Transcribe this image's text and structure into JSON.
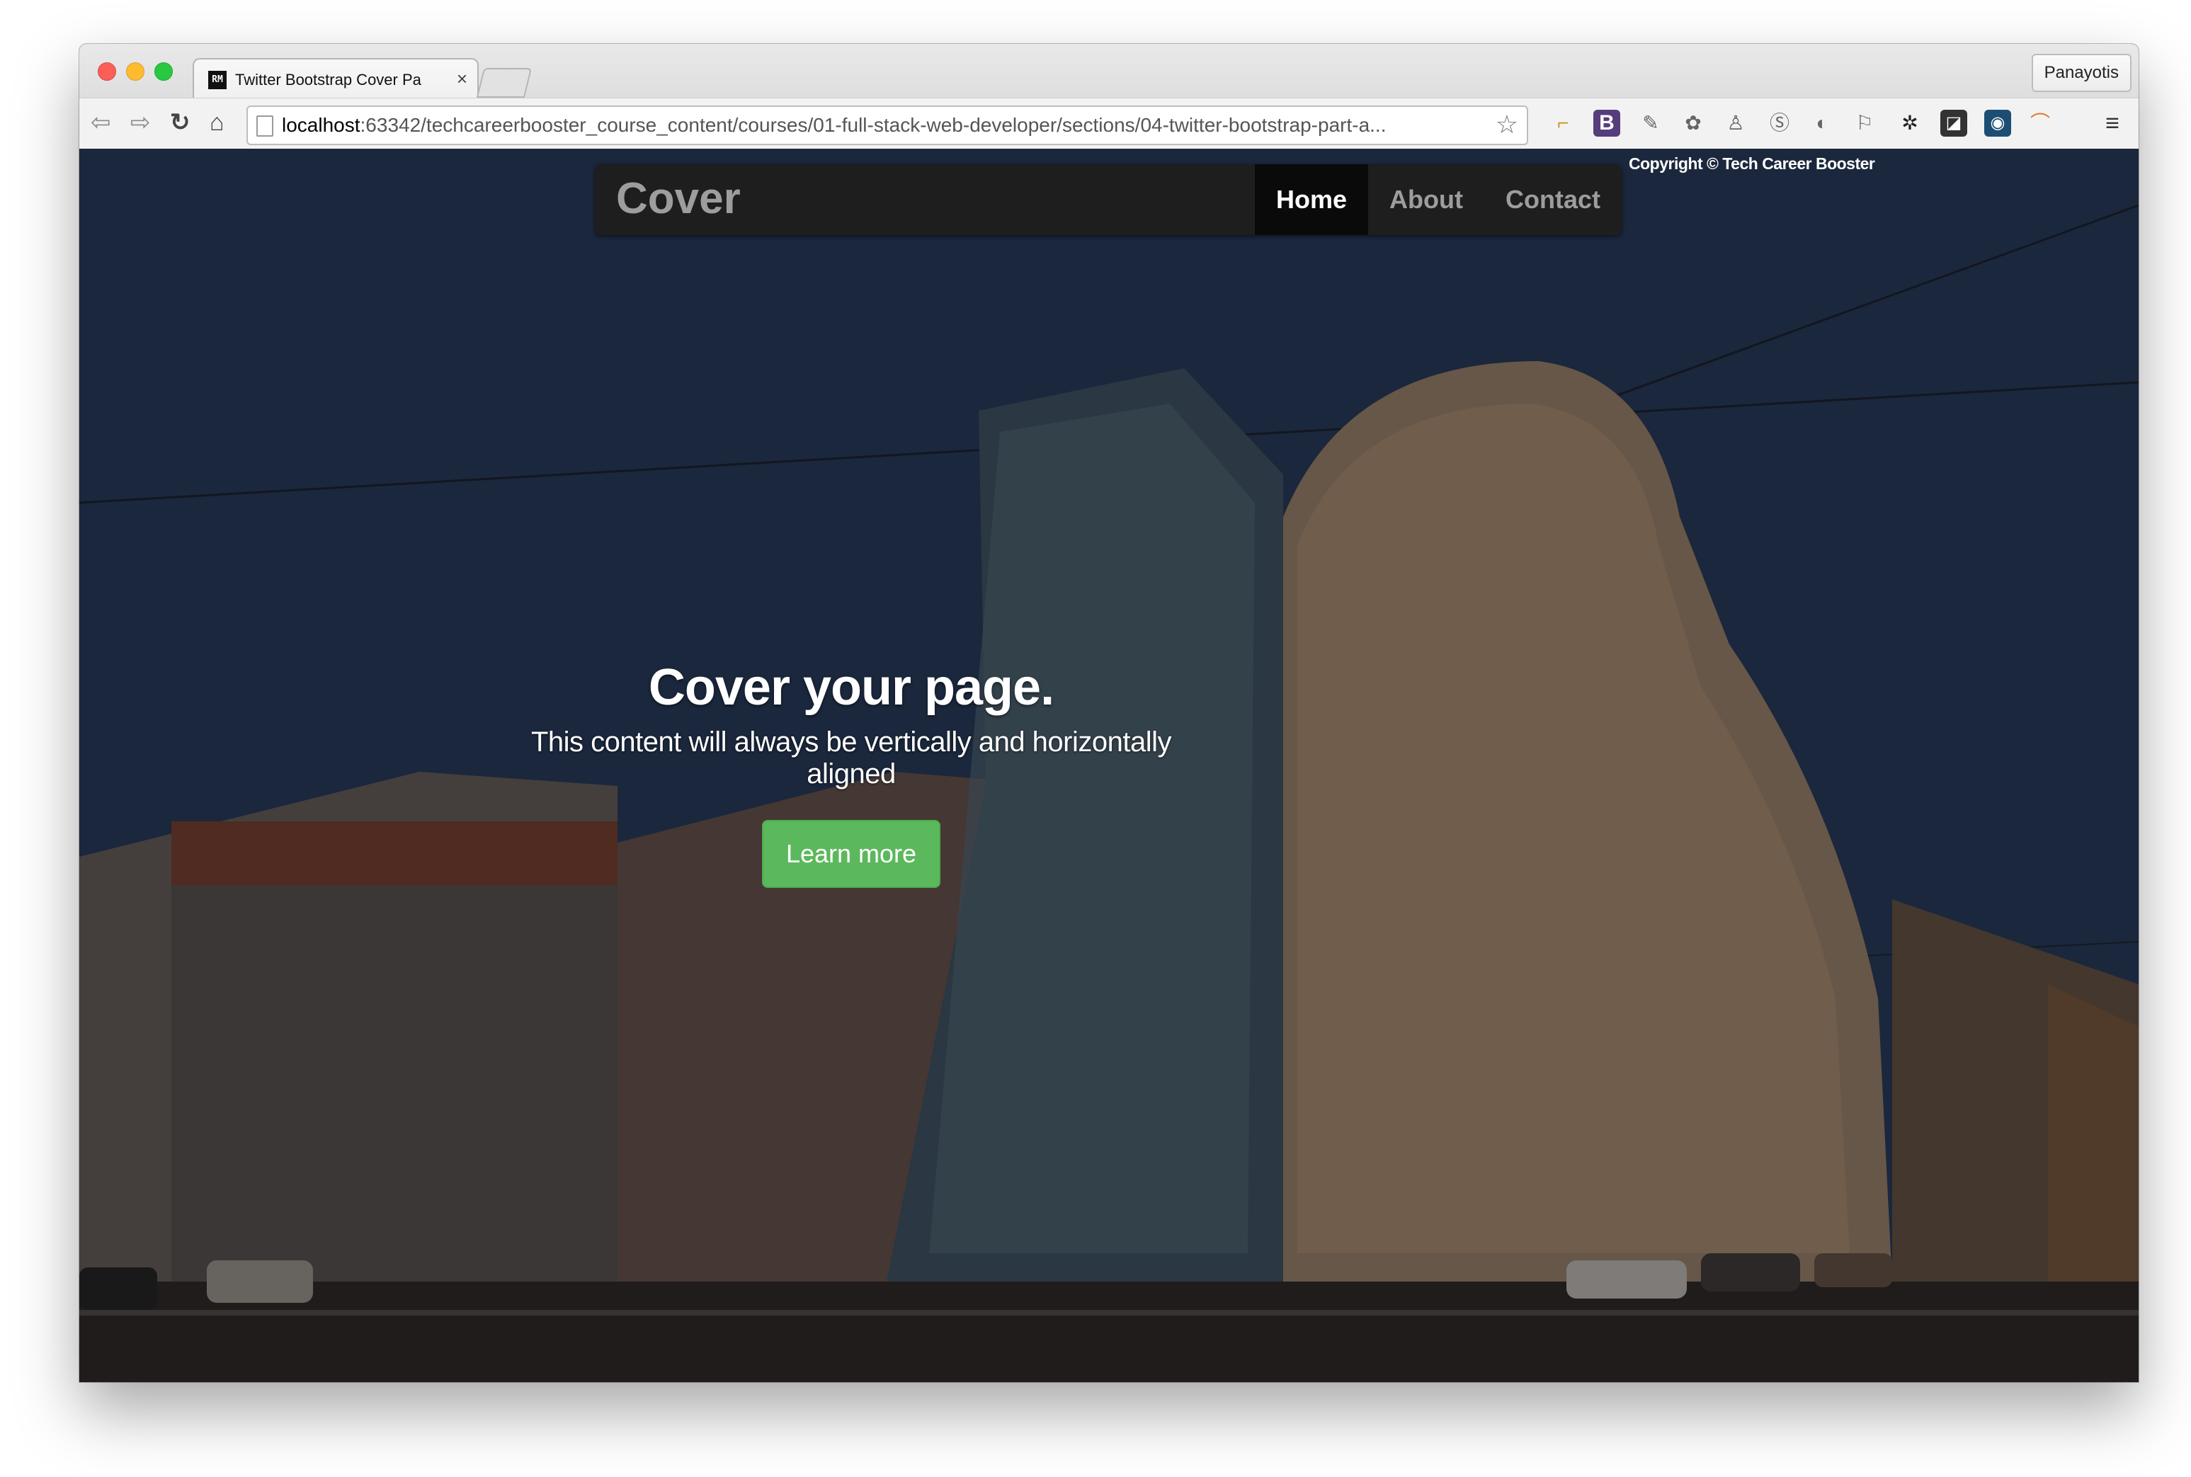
{
  "browser": {
    "tab_title": "Twitter Bootstrap Cover Pa",
    "tab_favicon_text": "RM",
    "close_glyph": "×",
    "profile_name": "Panayotis",
    "url_host": "localhost",
    "url_rest": ":63342/techcareerbooster_course_content/courses/01-full-stack-web-developer/sections/04-twitter-bootstrap-part-a...",
    "nav_glyphs": {
      "back": "⇦",
      "forward": "⇨",
      "reload": "↻",
      "home": "⌂",
      "star": "☆"
    },
    "extensions": [
      {
        "name": "bookmark-icon",
        "glyph": "⌐"
      },
      {
        "name": "bootstrap-icon",
        "glyph": "B"
      },
      {
        "name": "eyedropper-icon",
        "glyph": "✎"
      },
      {
        "name": "evernote-icon",
        "glyph": "✿"
      },
      {
        "name": "people-icon",
        "glyph": "♙"
      },
      {
        "name": "skype-icon",
        "glyph": "Ⓢ"
      },
      {
        "name": "sync-icon",
        "glyph": "◐"
      },
      {
        "name": "flag-icon",
        "glyph": "⚐"
      },
      {
        "name": "settings-wheel-icon",
        "glyph": "✲"
      },
      {
        "name": "square-icon",
        "glyph": "◪"
      },
      {
        "name": "pin-icon",
        "glyph": "◉"
      },
      {
        "name": "arc-icon",
        "glyph": "⌒"
      },
      {
        "name": "menu-icon",
        "glyph": "≡"
      }
    ]
  },
  "page": {
    "brand": "Cover",
    "nav": [
      {
        "label": "Home",
        "active": true
      },
      {
        "label": "About",
        "active": false
      },
      {
        "label": "Contact",
        "active": false
      }
    ],
    "copyright": "Copyright © Tech Career Booster",
    "hero": {
      "title": "Cover your page.",
      "lead": "This content will always be vertically and horizontally aligned",
      "button": "Learn more"
    },
    "colors": {
      "button": "#5cb85c",
      "navbar": "#1e1e1e",
      "nav_active": "#0a0a0a"
    }
  }
}
